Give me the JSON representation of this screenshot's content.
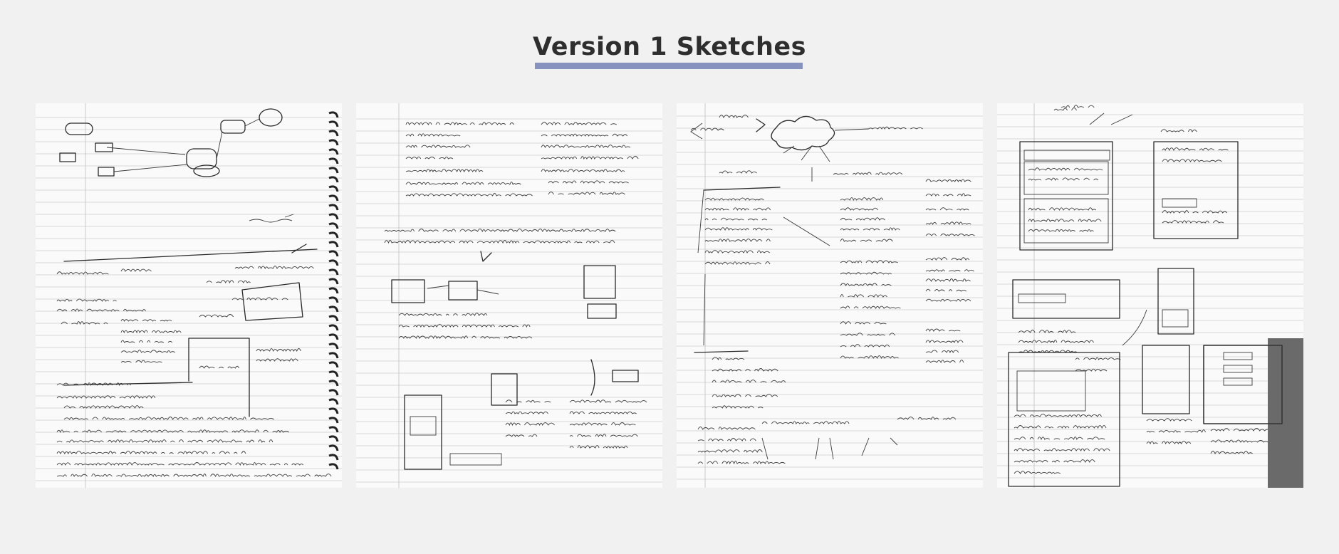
{
  "page": {
    "title": "Version 1 Sketches"
  }
}
